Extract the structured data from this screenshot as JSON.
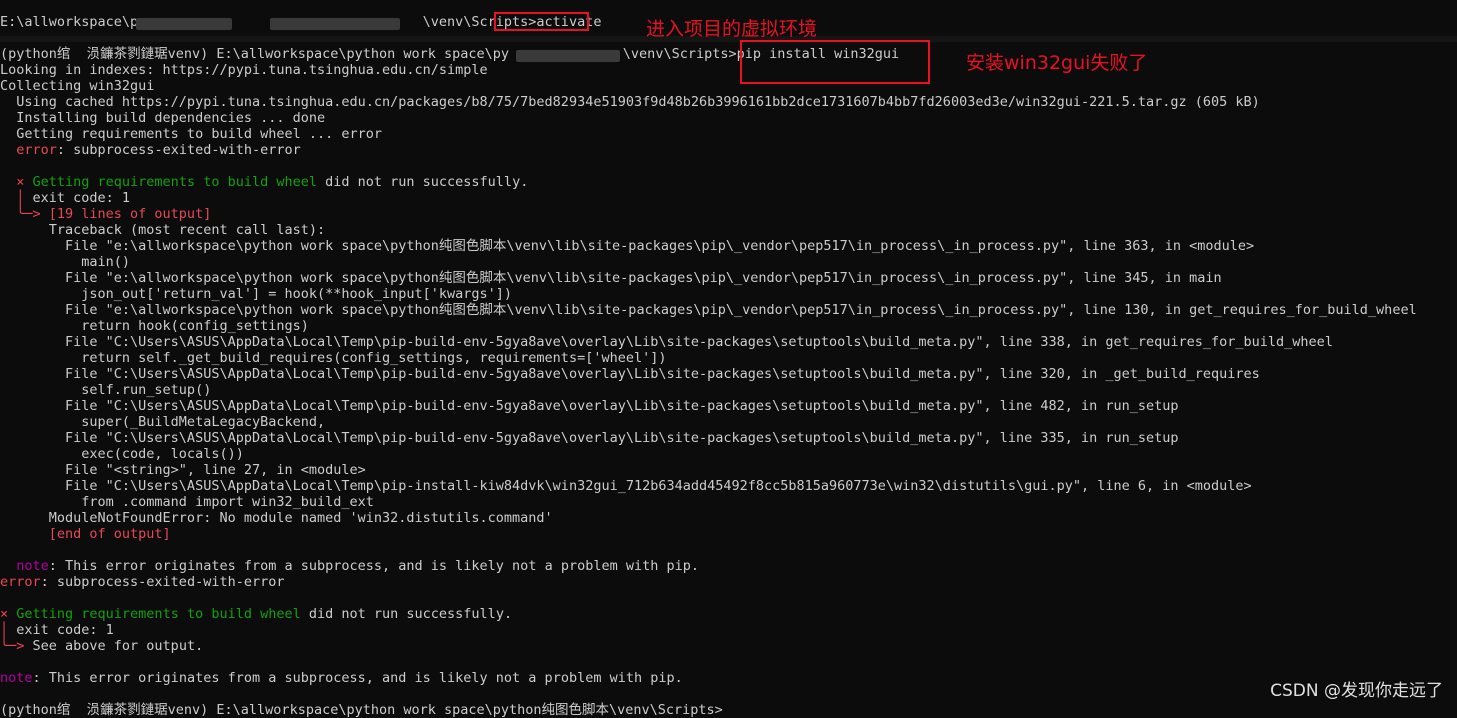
{
  "terminal": {
    "lines": [
      {
        "row": 1,
        "parts": [
          {
            "c": "w",
            "t": "E:\\allworkspace\\p"
          },
          {
            "c": "w",
            "t": "                                   \\venv\\Scripts>activate"
          }
        ]
      },
      {
        "row": 3,
        "parts": [
          {
            "c": "w",
            "t": "(python绾  涢鐮茶剹鏈琚venv) E:\\allworkspace\\python work space\\py"
          },
          {
            "c": "w",
            "t": "              \\venv\\Scripts>pip install win32gui"
          }
        ]
      },
      {
        "row": 4,
        "parts": [
          {
            "c": "w",
            "t": "Looking in indexes: https://pypi.tuna.tsinghua.edu.cn/simple"
          }
        ]
      },
      {
        "row": 5,
        "parts": [
          {
            "c": "w",
            "t": "Collecting win32gui"
          }
        ]
      },
      {
        "row": 6,
        "parts": [
          {
            "c": "w",
            "t": "  Using cached https://pypi.tuna.tsinghua.edu.cn/packages/b8/75/7bed82934e51903f9d48b26b3996161bb2dce1731607b4bb7fd26003ed3e/win32gui-221.5.tar.gz (605 kB)"
          }
        ]
      },
      {
        "row": 7,
        "parts": [
          {
            "c": "w",
            "t": "  Installing build dependencies ... done"
          }
        ]
      },
      {
        "row": 8,
        "parts": [
          {
            "c": "w",
            "t": "  Getting requirements to build wheel ... error"
          }
        ]
      },
      {
        "row": 9,
        "parts": [
          {
            "c": "r",
            "t": "  error"
          },
          {
            "c": "w",
            "t": ": subprocess-exited-with-error"
          }
        ]
      },
      {
        "row": 11,
        "parts": [
          {
            "c": "r",
            "t": "  × "
          },
          {
            "c": "g",
            "t": "Getting requirements to build wheel"
          },
          {
            "c": "w",
            "t": " did not run successfully."
          }
        ]
      },
      {
        "row": 12,
        "parts": [
          {
            "c": "r",
            "t": "  │ "
          },
          {
            "c": "w",
            "t": "exit code: "
          },
          {
            "c": "w",
            "t": "1"
          }
        ]
      },
      {
        "row": 13,
        "parts": [
          {
            "c": "r",
            "t": "  ╰─> [19 lines of output]"
          }
        ]
      },
      {
        "row": 14,
        "parts": [
          {
            "c": "w",
            "t": "      Traceback (most recent call last):"
          }
        ]
      },
      {
        "row": 15,
        "parts": [
          {
            "c": "w",
            "t": "        File \"e:\\allworkspace\\python work space\\python纯图色脚本\\venv\\lib\\site-packages\\pip\\_vendor\\pep517\\in_process\\_in_process.py\", line 363, in <module>"
          }
        ]
      },
      {
        "row": 16,
        "parts": [
          {
            "c": "w",
            "t": "          main()"
          }
        ]
      },
      {
        "row": 17,
        "parts": [
          {
            "c": "w",
            "t": "        File \"e:\\allworkspace\\python work space\\python纯图色脚本\\venv\\lib\\site-packages\\pip\\_vendor\\pep517\\in_process\\_in_process.py\", line 345, in main"
          }
        ]
      },
      {
        "row": 18,
        "parts": [
          {
            "c": "w",
            "t": "          json_out['return_val'] = hook(**hook_input['kwargs'])"
          }
        ]
      },
      {
        "row": 19,
        "parts": [
          {
            "c": "w",
            "t": "        File \"e:\\allworkspace\\python work space\\python纯图色脚本\\venv\\lib\\site-packages\\pip\\_vendor\\pep517\\in_process\\_in_process.py\", line 130, in get_requires_for_build_wheel"
          }
        ]
      },
      {
        "row": 20,
        "parts": [
          {
            "c": "w",
            "t": "          return hook(config_settings)"
          }
        ]
      },
      {
        "row": 21,
        "parts": [
          {
            "c": "w",
            "t": "        File \"C:\\Users\\ASUS\\AppData\\Local\\Temp\\pip-build-env-5gya8ave\\overlay\\Lib\\site-packages\\setuptools\\build_meta.py\", line 338, in get_requires_for_build_wheel"
          }
        ]
      },
      {
        "row": 22,
        "parts": [
          {
            "c": "w",
            "t": "          return self._get_build_requires(config_settings, requirements=['wheel'])"
          }
        ]
      },
      {
        "row": 23,
        "parts": [
          {
            "c": "w",
            "t": "        File \"C:\\Users\\ASUS\\AppData\\Local\\Temp\\pip-build-env-5gya8ave\\overlay\\Lib\\site-packages\\setuptools\\build_meta.py\", line 320, in _get_build_requires"
          }
        ]
      },
      {
        "row": 24,
        "parts": [
          {
            "c": "w",
            "t": "          self.run_setup()"
          }
        ]
      },
      {
        "row": 25,
        "parts": [
          {
            "c": "w",
            "t": "        File \"C:\\Users\\ASUS\\AppData\\Local\\Temp\\pip-build-env-5gya8ave\\overlay\\Lib\\site-packages\\setuptools\\build_meta.py\", line 482, in run_setup"
          }
        ]
      },
      {
        "row": 26,
        "parts": [
          {
            "c": "w",
            "t": "          super(_BuildMetaLegacyBackend,"
          }
        ]
      },
      {
        "row": 27,
        "parts": [
          {
            "c": "w",
            "t": "        File \"C:\\Users\\ASUS\\AppData\\Local\\Temp\\pip-build-env-5gya8ave\\overlay\\Lib\\site-packages\\setuptools\\build_meta.py\", line 335, in run_setup"
          }
        ]
      },
      {
        "row": 28,
        "parts": [
          {
            "c": "w",
            "t": "          exec(code, locals())"
          }
        ]
      },
      {
        "row": 29,
        "parts": [
          {
            "c": "w",
            "t": "        File \"<string>\", line 27, in <module>"
          }
        ]
      },
      {
        "row": 30,
        "parts": [
          {
            "c": "w",
            "t": "        File \"C:\\Users\\ASUS\\AppData\\Local\\Temp\\pip-install-kiw84dvk\\win32gui_712b634add45492f8cc5b815a960773e\\win32\\distutils\\gui.py\", line 6, in <module>"
          }
        ]
      },
      {
        "row": 31,
        "parts": [
          {
            "c": "w",
            "t": "          from .command import win32_build_ext"
          }
        ]
      },
      {
        "row": 32,
        "parts": [
          {
            "c": "w",
            "t": "      ModuleNotFoundError: No module named 'win32.distutils.command'"
          }
        ]
      },
      {
        "row": 33,
        "parts": [
          {
            "c": "r",
            "t": "      [end of output]"
          }
        ]
      },
      {
        "row": 35,
        "parts": [
          {
            "c": "m",
            "t": "  note"
          },
          {
            "c": "w",
            "t": ": This error originates from a subprocess, and is likely not a problem with pip."
          }
        ]
      },
      {
        "row": 36,
        "parts": [
          {
            "c": "r",
            "t": "error"
          },
          {
            "c": "w",
            "t": ": subprocess-exited-with-error"
          }
        ]
      },
      {
        "row": 38,
        "parts": [
          {
            "c": "r",
            "t": "× "
          },
          {
            "c": "g",
            "t": "Getting requirements to build wheel"
          },
          {
            "c": "w",
            "t": " did not run successfully."
          }
        ]
      },
      {
        "row": 39,
        "parts": [
          {
            "c": "r",
            "t": "│ "
          },
          {
            "c": "w",
            "t": "exit code: "
          },
          {
            "c": "w",
            "t": "1"
          }
        ]
      },
      {
        "row": 40,
        "parts": [
          {
            "c": "r",
            "t": "╰─> "
          },
          {
            "c": "w",
            "t": "See above for output."
          }
        ]
      },
      {
        "row": 42,
        "parts": [
          {
            "c": "m",
            "t": "note"
          },
          {
            "c": "w",
            "t": ": This error originates from a subprocess, and is likely not a problem with pip."
          }
        ]
      },
      {
        "row": 44,
        "parts": [
          {
            "c": "w",
            "t": "(python绾  涢鐮茶剹鏈琚venv) E:\\allworkspace\\python work space\\python纯图色脚本\\venv\\Scripts>"
          }
        ]
      }
    ]
  },
  "annotations": {
    "activate_note": "进入项目的虚拟环境",
    "install_note": "安装win32gui失败了"
  },
  "watermark": "CSDN @发现你走远了",
  "colors": {
    "background": "#0c0c0c",
    "text": "#cccccc",
    "error_red": "#e74856",
    "success_green": "#13a10e",
    "note_magenta": "#b4009e",
    "annotation_red": "#e81123"
  }
}
